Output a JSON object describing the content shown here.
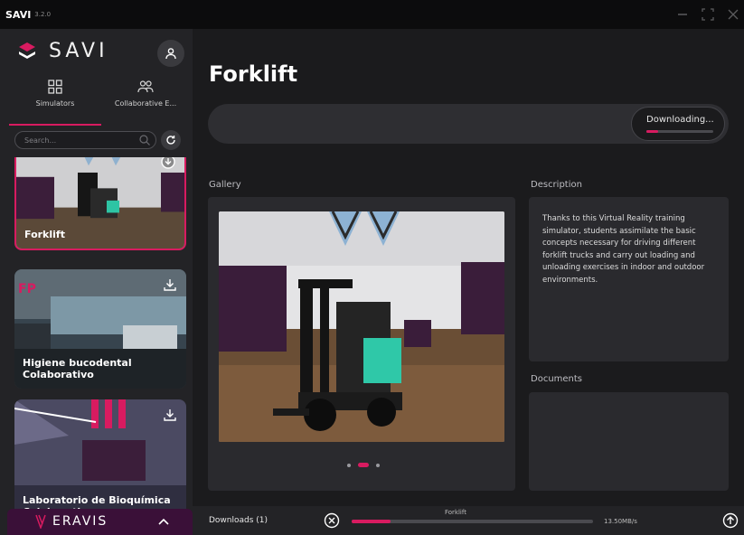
{
  "titlebar": {
    "app_name": "SAVI",
    "version": "3.2.0"
  },
  "sidebar": {
    "logo_text": "SAVI",
    "tabs": [
      {
        "label": "Simulators",
        "icon": "grid-icon",
        "active": true
      },
      {
        "label": "Collaborative E...",
        "icon": "users-icon",
        "active": false
      }
    ],
    "search_placeholder": "Search...",
    "cards": [
      {
        "name": "Forklift",
        "selected": true,
        "icon": "download-icon"
      },
      {
        "name": "Higiene bucodental Colaborativo",
        "selected": false,
        "icon": "download-icon"
      },
      {
        "name": "Laboratorio de Bioquímica Colaborativo",
        "selected": false,
        "icon": "download-icon"
      }
    ],
    "footer_brand": "ERAVIS"
  },
  "main": {
    "title": "Forklift",
    "download_status": "Downloading...",
    "download_progress": 0.18,
    "gallery_label": "Gallery",
    "gallery_page": 2,
    "gallery_pages": 3,
    "description_label": "Description",
    "description": "Thanks to this Virtual Reality training simulator, students assimilate the basic concepts necessary for driving different forklift trucks and carry out loading and unloading exercises in indoor and outdoor environments.",
    "documents_label": "Documents"
  },
  "downloads": {
    "label": "Downloads (1)",
    "item_name": "Forklift",
    "progress": 0.16,
    "speed": "13.50MB/s"
  },
  "colors": {
    "accent": "#d81b60",
    "footer": "#3a1038"
  }
}
